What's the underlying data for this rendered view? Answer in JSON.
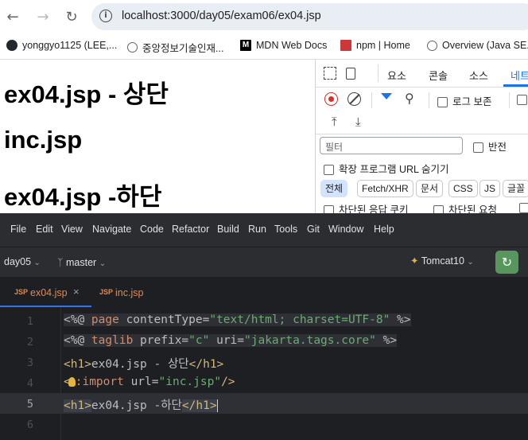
{
  "browser": {
    "url": "localhost:3000/day05/exam06/ex04.jsp",
    "bookmarks": [
      {
        "label": "yonggyo1125 (LEE,...",
        "icon": "github-icon"
      },
      {
        "label": "중앙정보기술인재...",
        "icon": "globe-icon"
      },
      {
        "label": "MDN Web Docs",
        "icon": "mdn-icon"
      },
      {
        "label": "npm | Home",
        "icon": "npm-icon"
      },
      {
        "label": "Overview (Java SE...",
        "icon": "globe-icon"
      }
    ]
  },
  "page": {
    "heading_top": "ex04.jsp - 상단",
    "heading_inc": "inc.jsp",
    "heading_bottom": "ex04.jsp -하단"
  },
  "devtools": {
    "tabs": [
      "요소",
      "콘솔",
      "소스",
      "네트"
    ],
    "preserve_log": "로그 보존",
    "filter_placeholder": "필터",
    "invert": "반전",
    "hide_extension_urls": "확장 프로그램 URL 숨기기",
    "type_filters": [
      "전체",
      "Fetch/XHR",
      "문서",
      "CSS",
      "JS",
      "글꼴"
    ],
    "blocked_response_cookies": "차단된 응답 쿠키",
    "blocked_requests": "차단된 요청"
  },
  "ide": {
    "menu": [
      "File",
      "Edit",
      "View",
      "Navigate",
      "Code",
      "Refactor",
      "Build",
      "Run",
      "Tools",
      "Git",
      "Window",
      "Help"
    ],
    "project": "day05",
    "branch": "master",
    "run_config": "Tomcat10",
    "tabs": [
      {
        "label": "ex04.jsp",
        "active": true
      },
      {
        "label": "inc.jsp",
        "active": false
      }
    ],
    "line_numbers": [
      "1",
      "2",
      "3",
      "4",
      "5",
      "6"
    ],
    "code": {
      "l1": {
        "open": "<%@ ",
        "kw": "page",
        "attr": " contentType=",
        "str": "\"text/html; charset=UTF-8\"",
        "close": " %>"
      },
      "l2": {
        "open": "<%@ ",
        "kw": "taglib",
        "attr1": " prefix=",
        "str1": "\"c\"",
        "attr2": " uri=",
        "str2": "\"jakarta.tags.core\"",
        "close": " %>"
      },
      "l3": {
        "open": "<h1>",
        "text": "ex04.jsp - 상단",
        "close": "</h1>"
      },
      "l4": {
        "open": "<",
        "prefix": ":import",
        "attr": " url=",
        "str": "\"inc.jsp\"",
        "close": "/>"
      },
      "l5": {
        "open": "<h1>",
        "text": "ex04.jsp -하단",
        "close": "</h1>"
      }
    }
  },
  "colors": {
    "accent_blue": "#1a73e8",
    "ide_bg": "#1e1f22",
    "ide_panel": "#2b2d30",
    "run_green": "#57965c"
  }
}
